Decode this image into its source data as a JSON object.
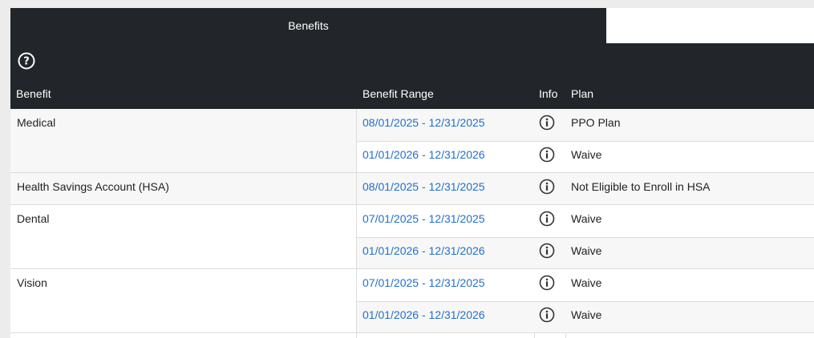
{
  "tabs": {
    "active_label": "Benefits"
  },
  "toolbar": {
    "help_icon": "question-circle-icon"
  },
  "table": {
    "headers": {
      "benefit": "Benefit",
      "range": "Benefit Range",
      "info": "Info",
      "plan": "Plan"
    },
    "groups": [
      {
        "benefit": "Medical",
        "rows": [
          {
            "range": "08/01/2025 - 12/31/2025",
            "plan": "PPO Plan"
          },
          {
            "range": "01/01/2026 - 12/31/2026",
            "plan": "Waive"
          }
        ]
      },
      {
        "benefit": "Health Savings Account (HSA)",
        "rows": [
          {
            "range": "08/01/2025 - 12/31/2025",
            "plan": "Not Eligible to Enroll in HSA"
          }
        ]
      },
      {
        "benefit": "Dental",
        "rows": [
          {
            "range": "07/01/2025 - 12/31/2025",
            "plan": "Waive"
          },
          {
            "range": "01/01/2026 - 12/31/2026",
            "plan": "Waive"
          }
        ]
      },
      {
        "benefit": "Vision",
        "rows": [
          {
            "range": "07/01/2025 - 12/31/2025",
            "plan": "Waive"
          },
          {
            "range": "01/01/2026 - 12/31/2026",
            "plan": "Waive"
          }
        ]
      }
    ]
  },
  "colors": {
    "header_bg": "#222529",
    "link": "#1f6fce",
    "row_alt": "#f7f7f7"
  }
}
